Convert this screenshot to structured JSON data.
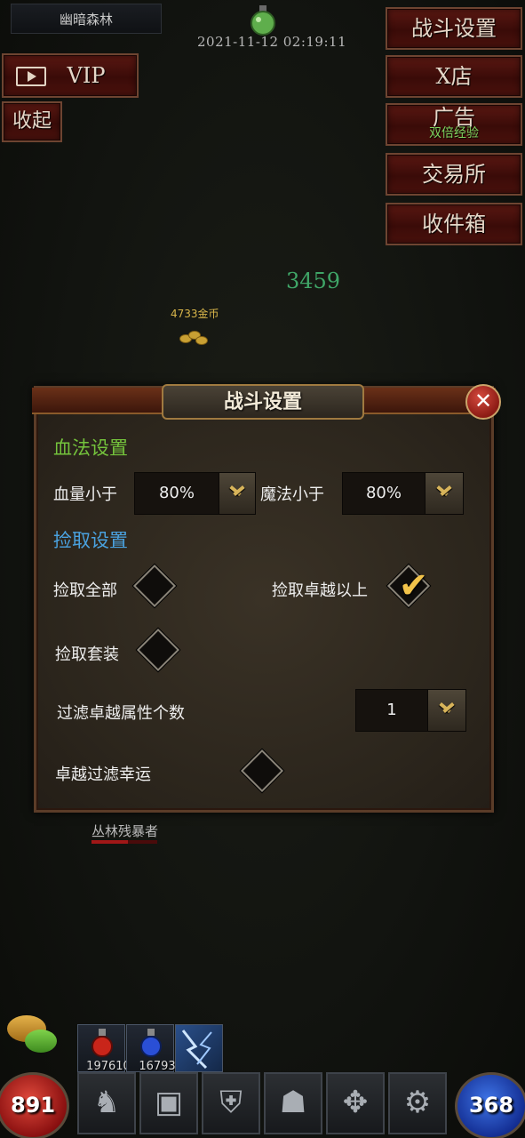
{
  "location": "幽暗森林",
  "timestamp": "2021-11-12 02:19:11",
  "left_buttons": {
    "vip": "VIP",
    "collapse": "收起"
  },
  "right_buttons": {
    "battle_settings": "战斗设置",
    "x_shop": "X店",
    "ad": "广告",
    "ad_sub": "双倍经验",
    "exchange": "交易所",
    "inbox": "收件箱"
  },
  "world": {
    "damage_number": "3459",
    "gold_drop": "4733金币",
    "monster_name": "丛林残暴者",
    "monster_hp_fraction": 0.55
  },
  "dialog": {
    "title": "战斗设置",
    "close": "✕",
    "blood_section": {
      "title": "血法设置",
      "hp_label": "血量小于",
      "hp_value": "80%",
      "mp_label": "魔法小于",
      "mp_value": "80%"
    },
    "pickup_section": {
      "title": "捡取设置",
      "pick_all": {
        "label": "捡取全部",
        "checked": false
      },
      "pick_excellent": {
        "label": "捡取卓越以上",
        "checked": true
      },
      "pick_set": {
        "label": "捡取套装",
        "checked": false
      },
      "filter_count_label": "过滤卓越属性个数",
      "filter_count_value": "1",
      "filter_luck": {
        "label": "卓越过滤幸运",
        "checked": false
      }
    }
  },
  "bottom": {
    "hp": "891",
    "mp": "368",
    "items": [
      {
        "name": "red-potion",
        "count": "197610"
      },
      {
        "name": "blue-potion",
        "count": "16793"
      },
      {
        "name": "lightning-skill",
        "count": ""
      }
    ],
    "menu_icons": [
      "character-icon",
      "bag-icon",
      "guild-icon",
      "skills-icon",
      "wings-icon",
      "settings-icon"
    ]
  },
  "colors": {
    "section_green": "#74c33c",
    "section_blue": "#4aa2e0",
    "check_gold": "#f2c34a",
    "damage_green": "#3fa567"
  }
}
